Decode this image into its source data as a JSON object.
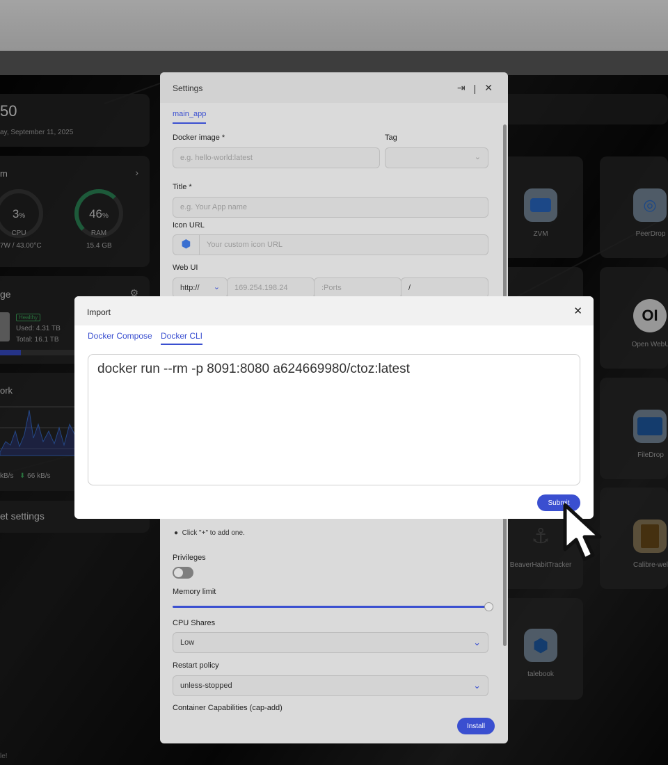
{
  "dashboard": {
    "clock_time": "50",
    "clock_date": "ay, September 11, 2025",
    "system_title": "m",
    "cpu_value": "3",
    "cpu_unit": "%",
    "cpu_label": "CPU",
    "cpu_sub": "7W / 43.00°C",
    "ram_value": "46",
    "ram_unit": "%",
    "ram_label": "RAM",
    "ram_sub": "15.4 GB",
    "cpu_percent": 3,
    "ram_percent": 46,
    "storage_title": "ge",
    "storage_badge": "Healthy",
    "storage_used": "Used: 4.31 TB",
    "storage_total": "Total: 16.1 TB",
    "network_title": "ork",
    "network_up": "kB/s",
    "network_down": "66 kB/s",
    "settings_item": "et settings",
    "bottom_note": "le!",
    "accent": "#3a4fd0"
  },
  "apps": [
    {
      "label": "ZVM",
      "icon": "zvm-icon"
    },
    {
      "label": "PeerDrop",
      "icon": "peerdrop-icon"
    },
    {
      "label": "Open WebU",
      "icon": "openwebui-icon"
    },
    {
      "label": "FileDrop",
      "icon": "folder-icon"
    },
    {
      "label": "BeaverHabitTracker",
      "icon": "beaver-icon"
    },
    {
      "label": "Calibre-wel",
      "icon": "book-icon"
    },
    {
      "label": "talebook",
      "icon": "cube-icon"
    }
  ],
  "settings": {
    "title": "Settings",
    "tab": "main_app",
    "docker_image_label": "Docker image *",
    "docker_image_placeholder": "e.g. hello-world:latest",
    "tag_label": "Tag",
    "title_label": "Title *",
    "title_placeholder": "e.g. Your App name",
    "icon_url_label": "Icon URL",
    "icon_url_placeholder": "Your custom icon URL",
    "webui_label": "Web UI",
    "webui_scheme": "http://",
    "webui_host": "169.254.198.24",
    "webui_ports": ":Ports",
    "webui_path": "/",
    "hint": "Click \"+\" to add one.",
    "privileges_label": "Privileges",
    "memory_label": "Memory limit",
    "memory_fraction": 1.0,
    "cpu_shares_label": "CPU Shares",
    "cpu_shares_value": "Low",
    "restart_label": "Restart policy",
    "restart_value": "unless-stopped",
    "capabilities_label": "Container Capabilities (cap-add)",
    "install_label": "Install"
  },
  "import": {
    "title": "Import",
    "tab_compose": "Docker Compose",
    "tab_cli": "Docker CLI",
    "command": "docker run --rm -p 8091:8080 a624669980/ctoz:latest",
    "submit_label": "Submit"
  }
}
